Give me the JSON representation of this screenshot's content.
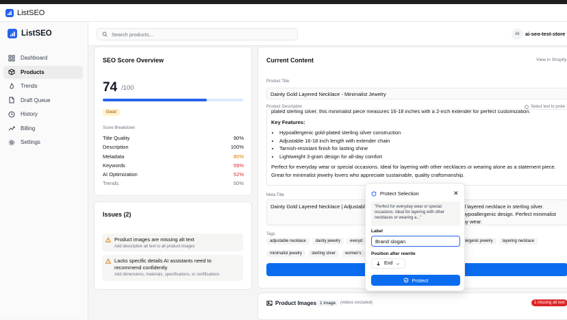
{
  "window": {
    "title": "ListSEO"
  },
  "brand": {
    "name": "ListSEO"
  },
  "sidebar": {
    "items": [
      {
        "label": "Dashboard",
        "icon": "dashboard-icon"
      },
      {
        "label": "Products",
        "icon": "box-icon",
        "active": true
      },
      {
        "label": "Trends",
        "icon": "flame-icon"
      },
      {
        "label": "Draft Queue",
        "icon": "file-icon"
      },
      {
        "label": "History",
        "icon": "history-icon"
      },
      {
        "label": "Billing",
        "icon": "trend-icon"
      },
      {
        "label": "Settings",
        "icon": "gear-icon"
      }
    ]
  },
  "header": {
    "search_placeholder": "Search products...",
    "avatar": "AI",
    "store": "ai-seo-test-store"
  },
  "score": {
    "title": "SEO Score Overview",
    "value": "74",
    "max": "/100",
    "progress": 0.74,
    "badge": "Good",
    "breakdown_title": "Score Breakdown",
    "rows": [
      {
        "label": "Title Quality",
        "value": "90%",
        "color": "#111827"
      },
      {
        "label": "Description",
        "value": "100%",
        "color": "#111827"
      },
      {
        "label": "Metadata",
        "value": "80%",
        "color": "#d97706"
      },
      {
        "label": "Keywords",
        "value": "59%",
        "color": "#dc2626"
      },
      {
        "label": "AI Optimization",
        "value": "52%",
        "color": "#dc2626"
      },
      {
        "label": "Trends",
        "value": "50%",
        "color": "#6b7280"
      }
    ]
  },
  "issues": {
    "title": "Issues (2)",
    "items": [
      {
        "title": "Product images are missing alt text",
        "desc": "Add descriptive alt text to all product images"
      },
      {
        "title": "Lacks specific details AI assistants need to recommend confidently",
        "desc": "Add dimensions, materials, specifications, or certifications"
      }
    ]
  },
  "content": {
    "title": "Current Content",
    "view_link": "View in Shopify",
    "product_title_label": "Product Title",
    "product_title": "Dainty Gold Layered Necklace - Minimalist Jewelry",
    "desc_label": "Product Description",
    "select_hint": "Select text to prote",
    "desc_intro": "plated sterling silver, this minimalist piece measures 16-18 inches with a 2-inch extender for perfect customization.",
    "features_title": "Key Features:",
    "features": [
      "Hypoallergenic gold-plated sterling silver construction",
      "Adjustable 16-18 inch length with extender chain",
      "Tarnish-resistant finish for lasting shine",
      "Lightweight 3-gram design for all-day comfort"
    ],
    "desc_outro": "Perfect for everyday wear or special occasions. Ideal for layering with other necklaces or wearing alone as a statement piece. Great for minimalist jewelry lovers who appreciate sustainable, quality craftsmanship.",
    "meta_label": "Meta Title",
    "meta_left": "Dainty Gold Layered Necklace | Adjustable",
    "meta_right_1": "d layered necklace in sterling silver.",
    "meta_right_2": "hypoallergenic design. Perfect minimalist",
    "meta_right_3": "ay wear.",
    "tags_label": "Tags",
    "tags_row1": [
      "adjustable necklace",
      "dainty jewelry",
      "everyd",
      "poallergenic jewelry",
      "layering necklace"
    ],
    "tags_row2": [
      "minimalist jewelry",
      "sterling silver",
      "women's"
    ]
  },
  "images": {
    "title": "Product Images",
    "count": "1 image",
    "note": "(videos excluded)",
    "badge": "1 missing alt text"
  },
  "popover": {
    "title": "Protect Selection",
    "quote": "\"Perfect for everyday wear or special occasions. Ideal for layering with other necklaces or wearing a...\"",
    "label_label": "Label",
    "label_value": "Brand slogan",
    "position_label": "Position after rewrite",
    "position_value": "End",
    "protect_button": "Protect"
  },
  "colors": {
    "accent": "#2563eb",
    "button": "#0b6cf0",
    "danger": "#dc2626",
    "warning": "#d97706"
  }
}
